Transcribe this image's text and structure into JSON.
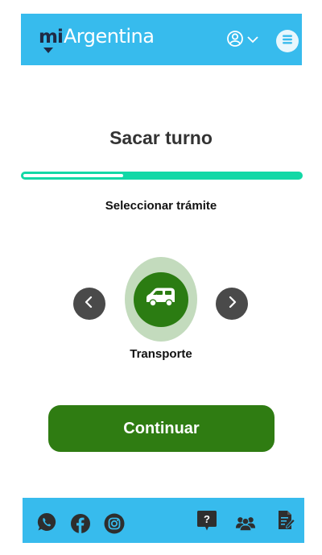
{
  "header": {
    "logo_mi": "mi",
    "logo_brand": "Argentina",
    "color": "#37bbed",
    "icons": [
      "user-icon",
      "chevron-down-icon",
      "menu-icon"
    ]
  },
  "main": {
    "title": "Sacar turno",
    "progress": 0.36,
    "step_label": "Seleccionar trámite",
    "option": {
      "label": "Transporte",
      "icon": "vehicle-icon"
    },
    "nav_icons": [
      "chevron-left-icon",
      "chevron-right-icon"
    ],
    "continue_label": "Continuar",
    "accent_color": "#2f7c12",
    "progress_color": "#12d8a6"
  },
  "footer": {
    "social_icons": [
      "whatsapp-icon",
      "facebook-icon",
      "instagram-icon"
    ],
    "utility_icons": [
      "help-icon",
      "community-icon",
      "document-icon"
    ]
  }
}
